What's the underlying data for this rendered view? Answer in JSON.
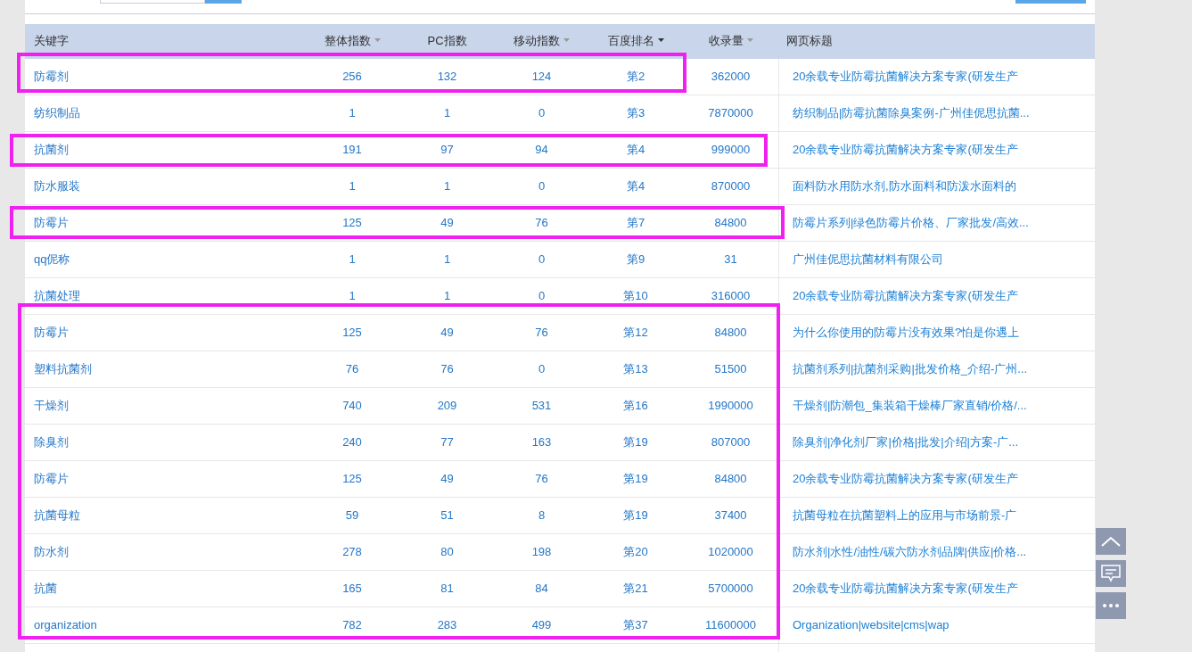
{
  "table": {
    "columns": [
      {
        "label": "关键字",
        "sortable": false,
        "sorted": false
      },
      {
        "label": "整体指数",
        "sortable": true,
        "sorted": false
      },
      {
        "label": "PC指数",
        "sortable": false,
        "sorted": false
      },
      {
        "label": "移动指数",
        "sortable": true,
        "sorted": false
      },
      {
        "label": "百度排名",
        "sortable": true,
        "sorted": true
      },
      {
        "label": "收录量",
        "sortable": true,
        "sorted": false
      },
      {
        "label": "网页标题",
        "sortable": false,
        "sorted": false
      }
    ],
    "rows": [
      [
        "防霉剂",
        "256",
        "132",
        "124",
        "第2",
        "362000",
        "20余载专业防霉抗菌解决方案专家(研发生产"
      ],
      [
        "纺织制品",
        "1",
        "1",
        "0",
        "第3",
        "7870000",
        "纺织制品|防霉抗菌除臭案例-广州佳伲思抗菌..."
      ],
      [
        "抗菌剂",
        "191",
        "97",
        "94",
        "第4",
        "999000",
        "20余载专业防霉抗菌解决方案专家(研发生产"
      ],
      [
        "防水服装",
        "1",
        "1",
        "0",
        "第4",
        "870000",
        "面料防水用防水剂,防水面料和防泼水面料的"
      ],
      [
        "防霉片",
        "125",
        "49",
        "76",
        "第7",
        "84800",
        "防霉片系列|绿色防霉片价格、厂家批发/高效..."
      ],
      [
        "qq伲称",
        "1",
        "1",
        "0",
        "第9",
        "31",
        "广州佳伲思抗菌材料有限公司"
      ],
      [
        "抗菌处理",
        "1",
        "1",
        "0",
        "第10",
        "316000",
        "20余载专业防霉抗菌解决方案专家(研发生产"
      ],
      [
        "防霉片",
        "125",
        "49",
        "76",
        "第12",
        "84800",
        "为什么你使用的防霉片没有效果?怕是你遇上"
      ],
      [
        "塑料抗菌剂",
        "76",
        "76",
        "0",
        "第13",
        "51500",
        "抗菌剂系列|抗菌剂采购|批发价格_介绍-广州..."
      ],
      [
        "干燥剂",
        "740",
        "209",
        "531",
        "第16",
        "1990000",
        "干燥剂|防潮包_集装箱干燥棒厂家直销/价格/..."
      ],
      [
        "除臭剂",
        "240",
        "77",
        "163",
        "第19",
        "807000",
        "除臭剂|净化剂厂家|价格|批发|介绍|方案-广..."
      ],
      [
        "防霉片",
        "125",
        "49",
        "76",
        "第19",
        "84800",
        "20余载专业防霉抗菌解决方案专家(研发生产"
      ],
      [
        "抗菌母粒",
        "59",
        "51",
        "8",
        "第19",
        "37400",
        "抗菌母粒在抗菌塑料上的应用与市场前景-广"
      ],
      [
        "防水剂",
        "278",
        "80",
        "198",
        "第20",
        "1020000",
        "防水剂|水性/油性/碳六防水剂品牌|供应|价格..."
      ],
      [
        "抗菌",
        "165",
        "81",
        "84",
        "第21",
        "5700000",
        "20余载专业防霉抗菌解决方案专家(研发生产"
      ],
      [
        "organization",
        "782",
        "283",
        "499",
        "第37",
        "11600000",
        "Organization|website|cms|wap"
      ]
    ]
  }
}
